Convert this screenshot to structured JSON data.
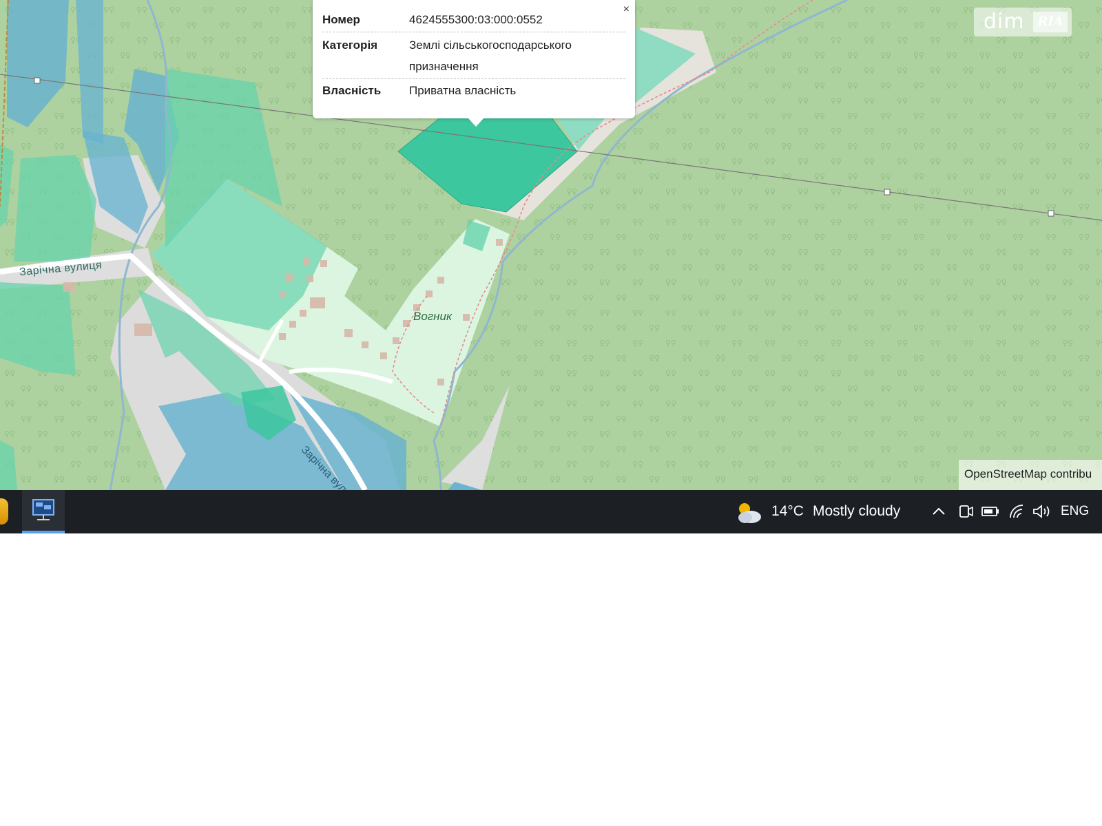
{
  "popup": {
    "close": "×",
    "rows": [
      {
        "key": "Номер",
        "value": "4624555300:03:000:0552"
      },
      {
        "key": "Категорія",
        "value": "Землі сільськогосподарського призначення"
      },
      {
        "key": "Власність",
        "value": "Приватна власність"
      }
    ]
  },
  "map": {
    "street_label_1": "Зарічна вулиця",
    "street_label_2": "Зарічна вули",
    "place_label": "Вогник",
    "attribution": "OpenStreetMap contribu",
    "colors": {
      "forest": "#aed1a0",
      "parcel_selected": "#3cc79f",
      "parcel_green": "#67d3ac",
      "parcel_blue": "#6ab4cf",
      "road": "#dcdcdc"
    }
  },
  "logo": {
    "text_dim": "dim",
    "text_ria": "RIA"
  },
  "taskbar": {
    "weather_temp": "14°C",
    "weather_text": "Mostly cloudy",
    "language": "ENG",
    "icons": [
      "start-icon",
      "network-app-icon",
      "weather-cloud-icon",
      "chevron-up-icon",
      "meet-now-icon",
      "battery-icon",
      "wifi-icon",
      "volume-icon"
    ]
  }
}
